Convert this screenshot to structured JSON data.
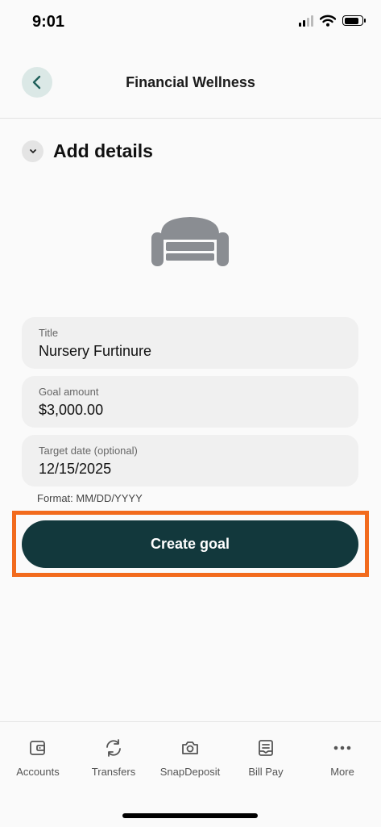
{
  "status_bar": {
    "time": "9:01",
    "icons": [
      "signal-icon",
      "wifi-icon",
      "battery-icon"
    ]
  },
  "header": {
    "title": "Financial Wellness",
    "back_icon": "chevron-left-icon"
  },
  "section": {
    "title": "Add details",
    "toggle_icon": "chevron-down-icon",
    "illustration_icon": "sofa-icon"
  },
  "form": {
    "title": {
      "label": "Title",
      "value": "Nursery Furtinure"
    },
    "goal_amount": {
      "label": "Goal amount",
      "value": "$3,000.00"
    },
    "target_date": {
      "label": "Target date (optional)",
      "value": "12/15/2025"
    },
    "format_hint": "Format: MM/DD/YYYY"
  },
  "cta": {
    "label": "Create goal",
    "highlight_color": "#f26b1d",
    "button_color": "#12383c"
  },
  "tabbar": {
    "items": [
      {
        "label": "Accounts",
        "icon": "wallet-icon"
      },
      {
        "label": "Transfers",
        "icon": "transfer-arrows-icon"
      },
      {
        "label": "SnapDeposit",
        "icon": "camera-icon"
      },
      {
        "label": "Bill Pay",
        "icon": "bill-icon"
      },
      {
        "label": "More",
        "icon": "more-dots-icon"
      }
    ]
  },
  "colors": {
    "accent": "#12383c",
    "back_button_bg": "#dbe8e6",
    "icon_gray": "#8a8d92"
  }
}
